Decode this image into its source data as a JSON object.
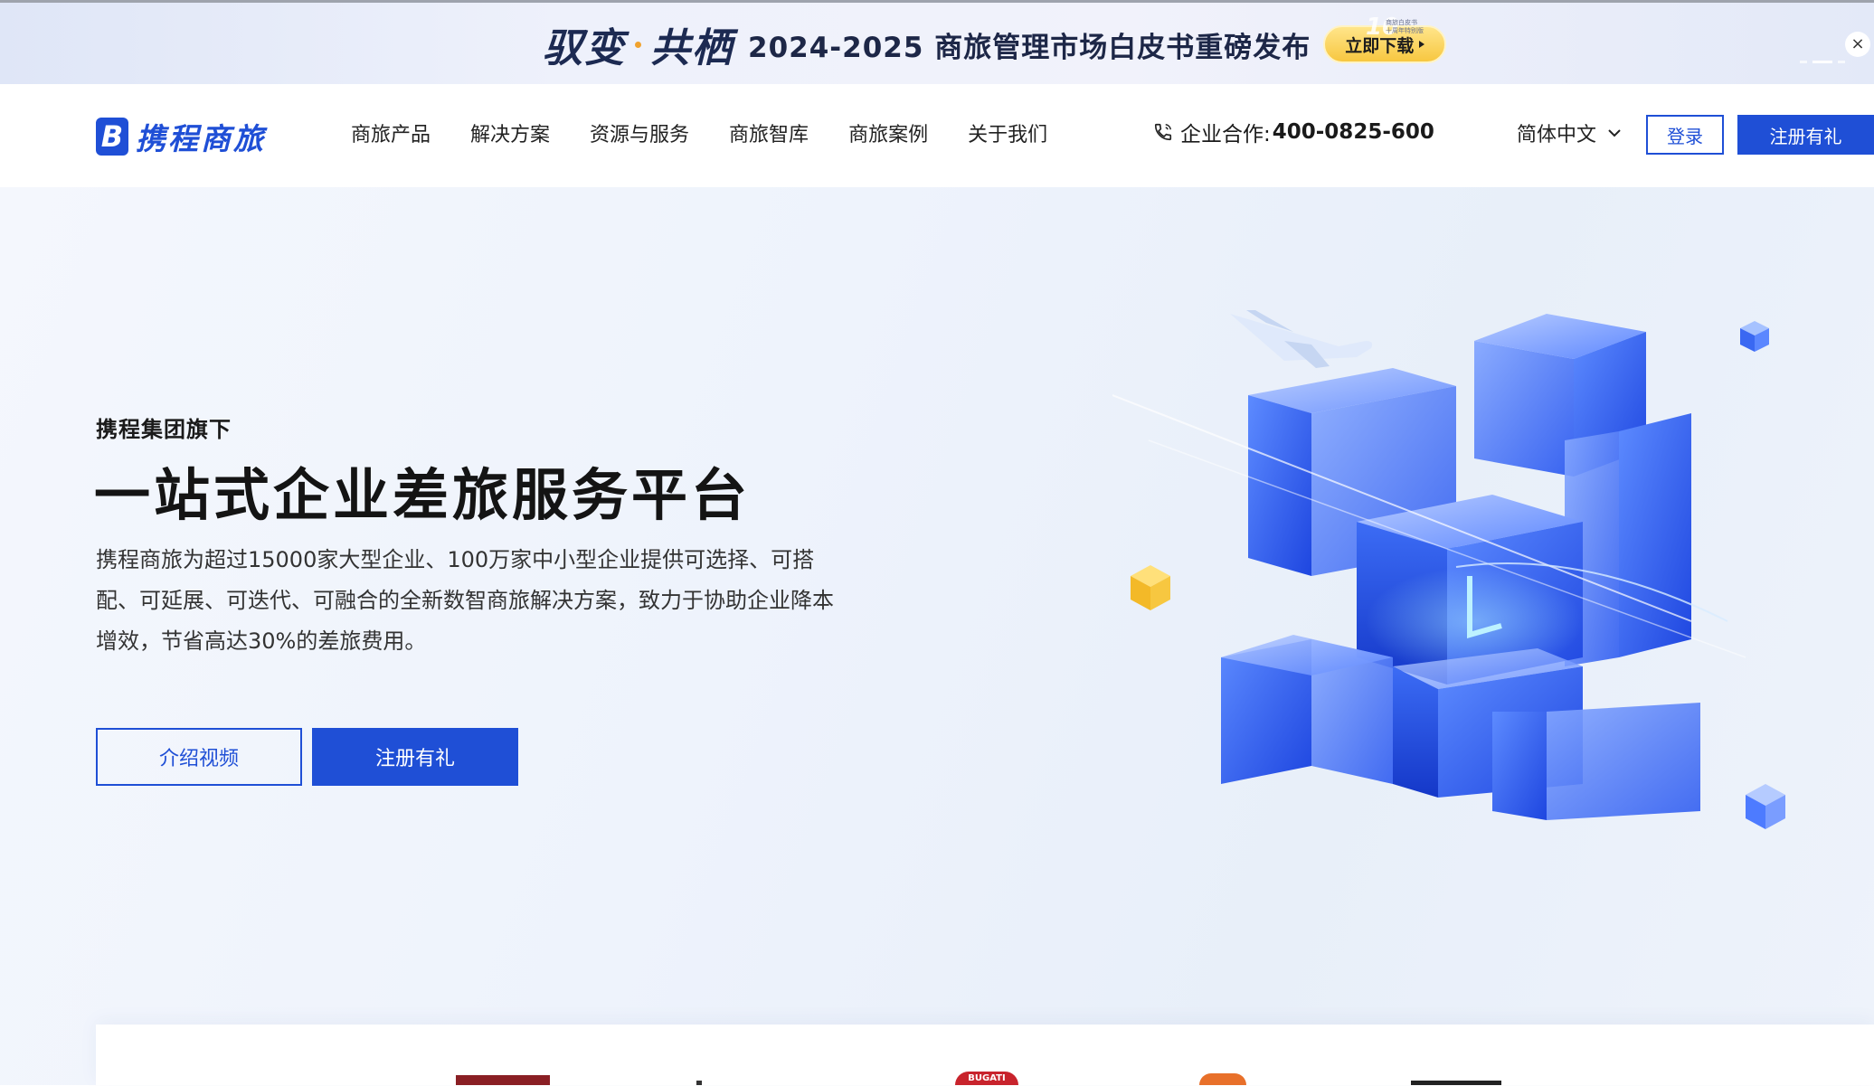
{
  "banner": {
    "slogan_left": "驭变",
    "slogan_right": "共栖",
    "headline": "2024-2025 商旅管理市场白皮书重磅发布",
    "download_label": "立即下载",
    "badge_number": "10",
    "badge_line1": "商旅白皮书",
    "badge_line2": "十周年特别版",
    "close_label": "×"
  },
  "nav": {
    "brand": "携程商旅",
    "brand_mark": "B",
    "links": [
      "商旅产品",
      "解决方案",
      "资源与服务",
      "商旅智库",
      "商旅案例",
      "关于我们"
    ],
    "phone_label": "企业合作:",
    "phone_number": "400-0825-600",
    "language": "简体中文",
    "login_label": "登录",
    "register_label": "注册有礼"
  },
  "hero": {
    "kicker": "携程集团旗下",
    "title": "一站式企业差旅服务平台",
    "description": "携程商旅为超过15000家大型企业、100万家中小型企业提供可选择、可搭配、可延展、可迭代、可融合的全新数智商旅解决方案，致力于协助企业降本增效，节省高达30%的差旅费用。",
    "video_button": "介绍视频",
    "register_button": "注册有礼"
  },
  "partners": {
    "logo3_text": "BUGATI"
  },
  "colors": {
    "brand_blue": "#1f4fd6",
    "accent_yellow": "#f7c740",
    "text_dark": "#141414"
  },
  "icons": {
    "phone": "phone-icon",
    "chevron": "chevron-down-icon",
    "close": "close-icon"
  }
}
